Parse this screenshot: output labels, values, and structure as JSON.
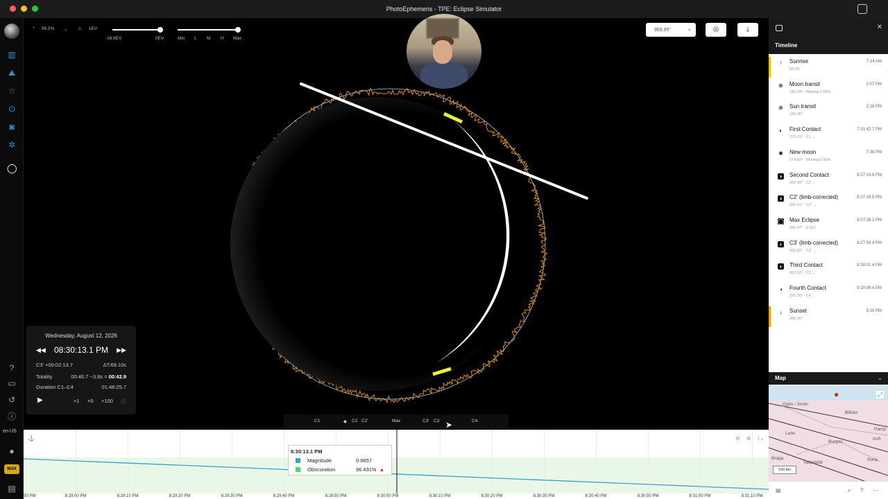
{
  "window": {
    "title": "PhotoEphemeris - TPE: Eclipse Simulator",
    "traffic_colors": [
      "#ff5f57",
      "#febc2e",
      "#28c840"
    ]
  },
  "toolbar": {
    "obscuration": "99.5%",
    "ev_label": "±EV",
    "ev_low": "-16.6EV",
    "ev_zero": "0EV",
    "quality_labels": [
      "Min",
      "L",
      "M",
      "H",
      "Max"
    ],
    "azimuth_value": "959.95°"
  },
  "sidebar": {
    "locale": "en-US",
    "max_badge": "MAX",
    "icons": [
      "user-avatar",
      "map-icon",
      "mountain-icon",
      "star-icon",
      "pin-icon",
      "camera-icon",
      "settings-icon",
      "eclipse-icon"
    ],
    "bottom_icons": [
      "help-icon",
      "chat-icon",
      "history-icon",
      "info-icon"
    ]
  },
  "info": {
    "date": "Wednesday, August 12, 2026",
    "time": "08:30:13.1 PM",
    "c3_offset": "C3' +00:02:13.7",
    "delta_t": "ΔT:69.10s",
    "totality_label": "Totality",
    "totality_range": "00:46.7 −3.8s =",
    "totality_value": "00:42.9",
    "duration_label": "Duration C1–C4",
    "duration_value": "01:48:25.7",
    "speeds": [
      "×1",
      "×5",
      "×100"
    ]
  },
  "contacts": [
    "C1",
    "C2",
    "C2'",
    "Max",
    "C3'",
    "C3",
    "C4"
  ],
  "graph": {
    "tooltip_time": "8:30:13.1 PM",
    "magnitude_label": "Magnitude",
    "magnitude_value": "0.9657",
    "obscuration_label": "Obscuration",
    "obscuration_value": "96.431%",
    "ticks": [
      "8:29:00 PM",
      "8:29:10 PM",
      "8:29:20 PM",
      "8:29:30 PM",
      "8:29:40 PM",
      "8:29:50 PM",
      "8:30:00 PM",
      "8:30:10 PM",
      "8:30:20 PM",
      "8:30:30 PM",
      "8:30:40 PM",
      "8:30:50 PM",
      "8:31:00 PM",
      "8:31:10 PM"
    ],
    "left_partial_tick": ":50 PM",
    "magnitude_color": "#3aa0c8",
    "obscuration_color": "#5ccf6a"
  },
  "timeline": {
    "title": "Timeline",
    "items": [
      {
        "name": "Sunrise",
        "sub": "68.39°",
        "time": "7:14 AM",
        "icon": "↑",
        "bar": "#f2c200"
      },
      {
        "name": "Moon transit",
        "sub": "180.03° · Waning 0.08%",
        "time": "2:07 PM",
        "icon": "⊕",
        "bar": ""
      },
      {
        "name": "Sun transit",
        "sub": "180.00°",
        "time": "2:18 PM",
        "icon": "⊕",
        "bar": ""
      },
      {
        "name": "First Contact",
        "sub": "273.19° · C1 →",
        "time": "7:31:42.7 PM",
        "icon": "◐",
        "bar": ""
      },
      {
        "name": "New moon",
        "sub": "274.50° · Waning 0.00%",
        "time": "7:36 PM",
        "icon": "✱",
        "bar": ""
      },
      {
        "name": "Second Contact",
        "sub": "282.40° · C2 →",
        "time": "8:27:14.8 PM",
        "icon": "◖",
        "bar": ""
      },
      {
        "name": "C2' (limb-corrected)",
        "sub": "282.41° · C2' →",
        "time": "8:27:16.5 PM",
        "icon": "◖",
        "bar": ""
      },
      {
        "name": "Max Eclipse",
        "sub": "282.47° · 1.002",
        "time": "8:27:38.2 PM",
        "icon": "◯",
        "bar": ""
      },
      {
        "name": "C3' (limb-corrected)",
        "sub": "282.52° · C3' ←",
        "time": "8:27:59.4 PM",
        "icon": "◗",
        "bar": ""
      },
      {
        "name": "Third Contact",
        "sub": "282.53° · C3 ←",
        "time": "8:28:01.4 PM",
        "icon": "◗",
        "bar": ""
      },
      {
        "name": "Fourth Contact",
        "sub": "291.30° · C4 ←",
        "time": "9:20:08.4 PM",
        "icon": "◑",
        "bar": ""
      },
      {
        "name": "Sunset",
        "sub": "291.36°",
        "time": "9:20 PM",
        "icon": "↓",
        "bar": "#f2a200"
      }
    ]
  },
  "map": {
    "title": "Map",
    "labels": [
      "Gijón / Xixón",
      "Bilbao",
      "Pamp",
      "Iruñ",
      "León",
      "Burgos",
      "Valladolid",
      "Soria",
      "Braga"
    ],
    "scale": "100 km"
  }
}
